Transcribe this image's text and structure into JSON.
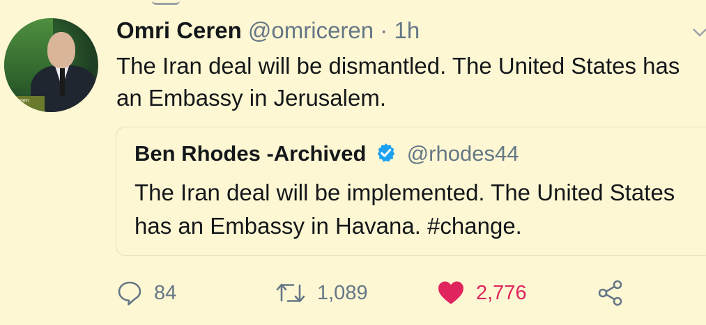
{
  "tweet": {
    "author_name": "Omri Ceren",
    "author_handle": "@omriceren",
    "separator": "·",
    "time": "1h",
    "text": "The Iran deal will be dismantled. The United States has an Embassy in Jerusalem.",
    "avatar_caption": "ri Ceren",
    "avatar_icon": "profile-photo"
  },
  "quoted_tweet": {
    "author_name": "Ben Rhodes -Archived",
    "verified_icon": "verified-badge-icon",
    "author_handle": "@rhodes44",
    "text": "The Iran deal will be implemented. The United States has an Embassy in Havana. #change."
  },
  "actions": {
    "reply": {
      "icon": "reply-icon",
      "count": "84"
    },
    "retweet": {
      "icon": "retweet-icon",
      "count": "1,089"
    },
    "like": {
      "icon": "heart-icon",
      "count": "2,776",
      "liked": true
    },
    "share": {
      "icon": "share-icon"
    }
  },
  "colors": {
    "background": "#fdf7d3",
    "text": "#14171a",
    "secondary": "#657786",
    "like": "#e0245e",
    "verified": "#1da1f2"
  }
}
